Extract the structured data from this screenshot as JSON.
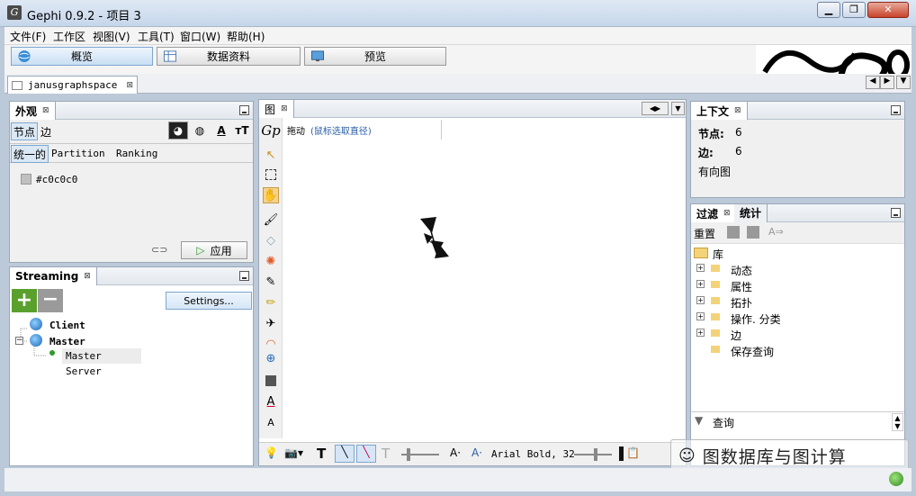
{
  "window": {
    "title": "Gephi 0.9.2 - 项目 3",
    "minimize": "▁",
    "restore": "❐",
    "close": "✕"
  },
  "menu": [
    "文件(F)",
    "工作区",
    "视图(V)",
    "工具(T)",
    "窗口(W)",
    "帮助(H)"
  ],
  "modes": {
    "overview": "概览",
    "data": "数据资料",
    "preview": "预览"
  },
  "doc_tab": {
    "label": "janusgraphspace"
  },
  "appearance": {
    "title": "外观",
    "tab_nodes": "节点",
    "tab_edges": "边",
    "sub_unique": "统一的",
    "sub_partition": "Partition",
    "sub_ranking": "Ranking",
    "color_value": "#c0c0c0",
    "apply": "应用",
    "swatch_color": "#c0c0c0"
  },
  "streaming": {
    "title": "Streaming",
    "settings": "Settings...",
    "tree": {
      "client": "Client",
      "master": "Master",
      "server": "Master Server"
    }
  },
  "graph": {
    "title": "图",
    "drag_label": "拖动",
    "drag_hint": "(鼠标选取直径)",
    "font_label": "Arial Bold, 32"
  },
  "context": {
    "title": "上下文",
    "nodes_label": "节点:",
    "nodes_value": "6",
    "edges_label": "边:",
    "edges_value": "6",
    "graph_type": "有向图"
  },
  "filters": {
    "tab_filter": "过滤",
    "tab_stats": "统计",
    "reset": "重置",
    "library": "库",
    "items": [
      "动态",
      "属性",
      "拓扑",
      "操作. 分类",
      "边",
      "保存查询"
    ],
    "query": "查询"
  },
  "watermark": "图数据库与图计算",
  "colors": {
    "accent": "#7fa7cf",
    "green": "#2e9a2e"
  }
}
